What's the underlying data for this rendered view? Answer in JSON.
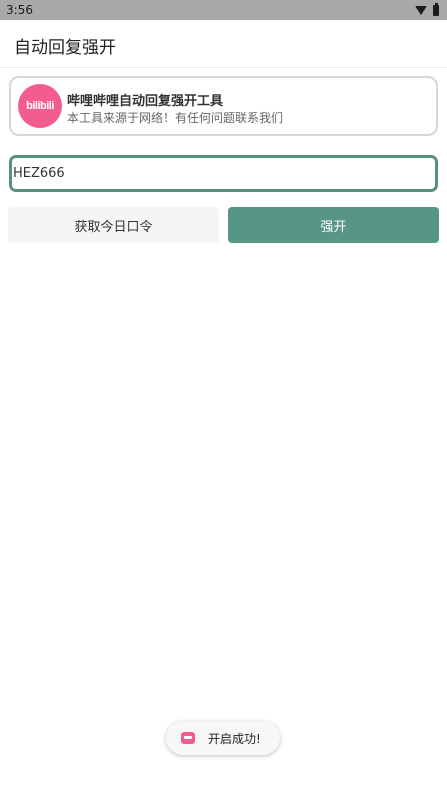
{
  "status_bar": {
    "time": "3:56"
  },
  "app_bar": {
    "title": "自动回复强开"
  },
  "info_card": {
    "logo_text": "bilibili",
    "title": "哔哩哔哩自动回复强开工具",
    "subtitle": "本工具来源于网络！有任何问题联系我们"
  },
  "code_input": {
    "value": "HEZ666"
  },
  "buttons": {
    "get_code_label": "获取今日口令",
    "force_open_label": "强开"
  },
  "toast": {
    "text": "开启成功!"
  },
  "colors": {
    "accent": "#579686",
    "input_border": "#5a8f83",
    "bilibili_pink": "#f25d8e",
    "status_bar": "#a9a9a9"
  }
}
